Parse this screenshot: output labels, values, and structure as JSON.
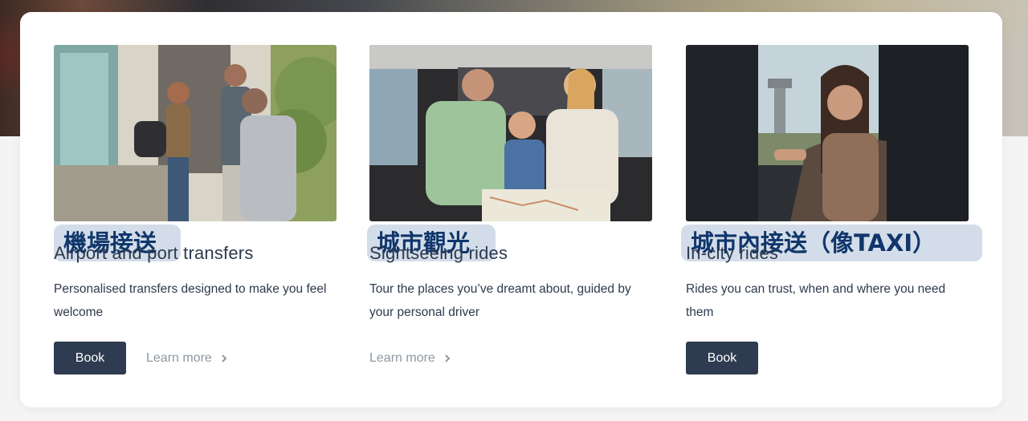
{
  "cards": [
    {
      "tag": "機場接送",
      "title": "Airport and port transfers",
      "description": "Personalised transfers designed to make you feel welcome",
      "book_label": "Book",
      "learn_more_label": "Learn more",
      "image_alt": "Travellers greeting a driver at an airport terminal"
    },
    {
      "tag": "城市觀光",
      "title": "Sightseeing rides",
      "description": "Tour the places you’ve dreamt about, guided by your personal driver",
      "learn_more_label": "Learn more",
      "image_alt": "Family reading a map in the back seat of a car"
    },
    {
      "tag": "城市內接送（像TAXI）",
      "title": "In-city rides",
      "description": "Rides you can trust, when and where you need them",
      "book_label": "Book",
      "image_alt": "Woman smiling in the back seat of a car near an airport tower"
    }
  ],
  "icons": {
    "learn_more": "chevron-right-icon"
  },
  "colors": {
    "button_bg": "#2e3b50",
    "tag_bg": "#d3dde9",
    "tag_text": "#10366b",
    "link_text": "#8e97a3"
  }
}
